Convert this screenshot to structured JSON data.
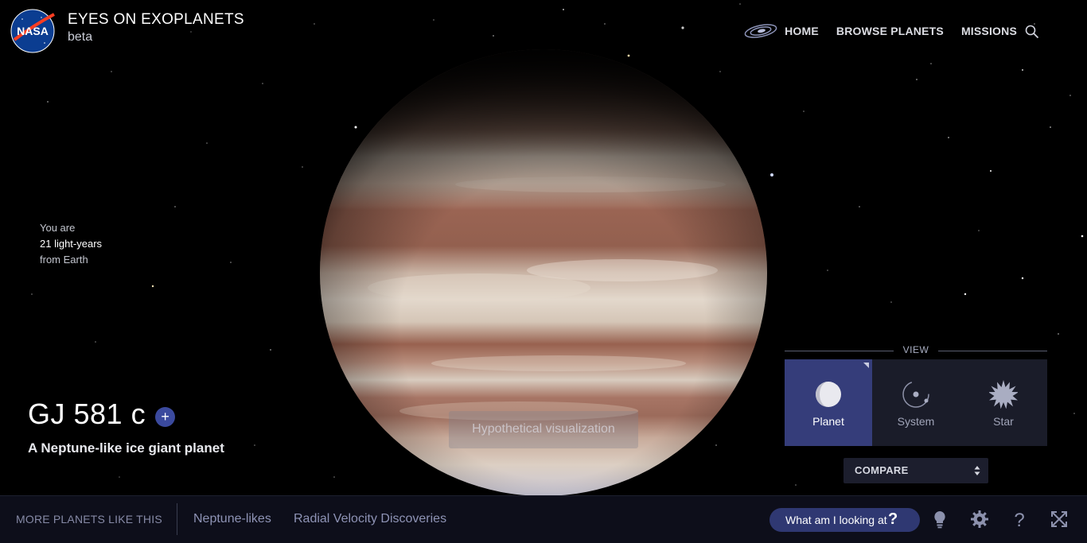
{
  "header": {
    "app_title": "EYES ON EXOPLANETS",
    "app_subtitle": "beta",
    "logo_text": "NASA",
    "nav": {
      "home": "HOME",
      "browse": "BROWSE PLANETS",
      "missions": "MISSIONS"
    }
  },
  "distance": {
    "line1": "You are",
    "line2": "21 light-years",
    "line3": "from Earth"
  },
  "planet": {
    "name": "GJ 581 c",
    "add_symbol": "+",
    "description": "A Neptune-like ice giant planet",
    "overlay": "Hypothetical visualization"
  },
  "view": {
    "label": "VIEW",
    "options": [
      {
        "label": "Planet",
        "active": true
      },
      {
        "label": "System",
        "active": false
      },
      {
        "label": "Star",
        "active": false
      }
    ]
  },
  "compare": {
    "label": "COMPARE"
  },
  "bottombar": {
    "more_label": "MORE PLANETS LIKE THIS",
    "links": [
      "Neptune-likes",
      "Radial Velocity Discoveries"
    ],
    "help_button": "What am I looking at",
    "help_symbol": "?"
  },
  "colors": {
    "accent": "#353d7a",
    "help_button": "#2f3872",
    "bar_bg": "#0d0e1a"
  },
  "icons": [
    "nasa-logo",
    "galaxy-icon",
    "search-icon",
    "planet-icon",
    "system-icon",
    "star-icon",
    "select-arrows-icon",
    "lightbulb-icon",
    "gear-icon",
    "help-icon",
    "fullscreen-icon"
  ]
}
